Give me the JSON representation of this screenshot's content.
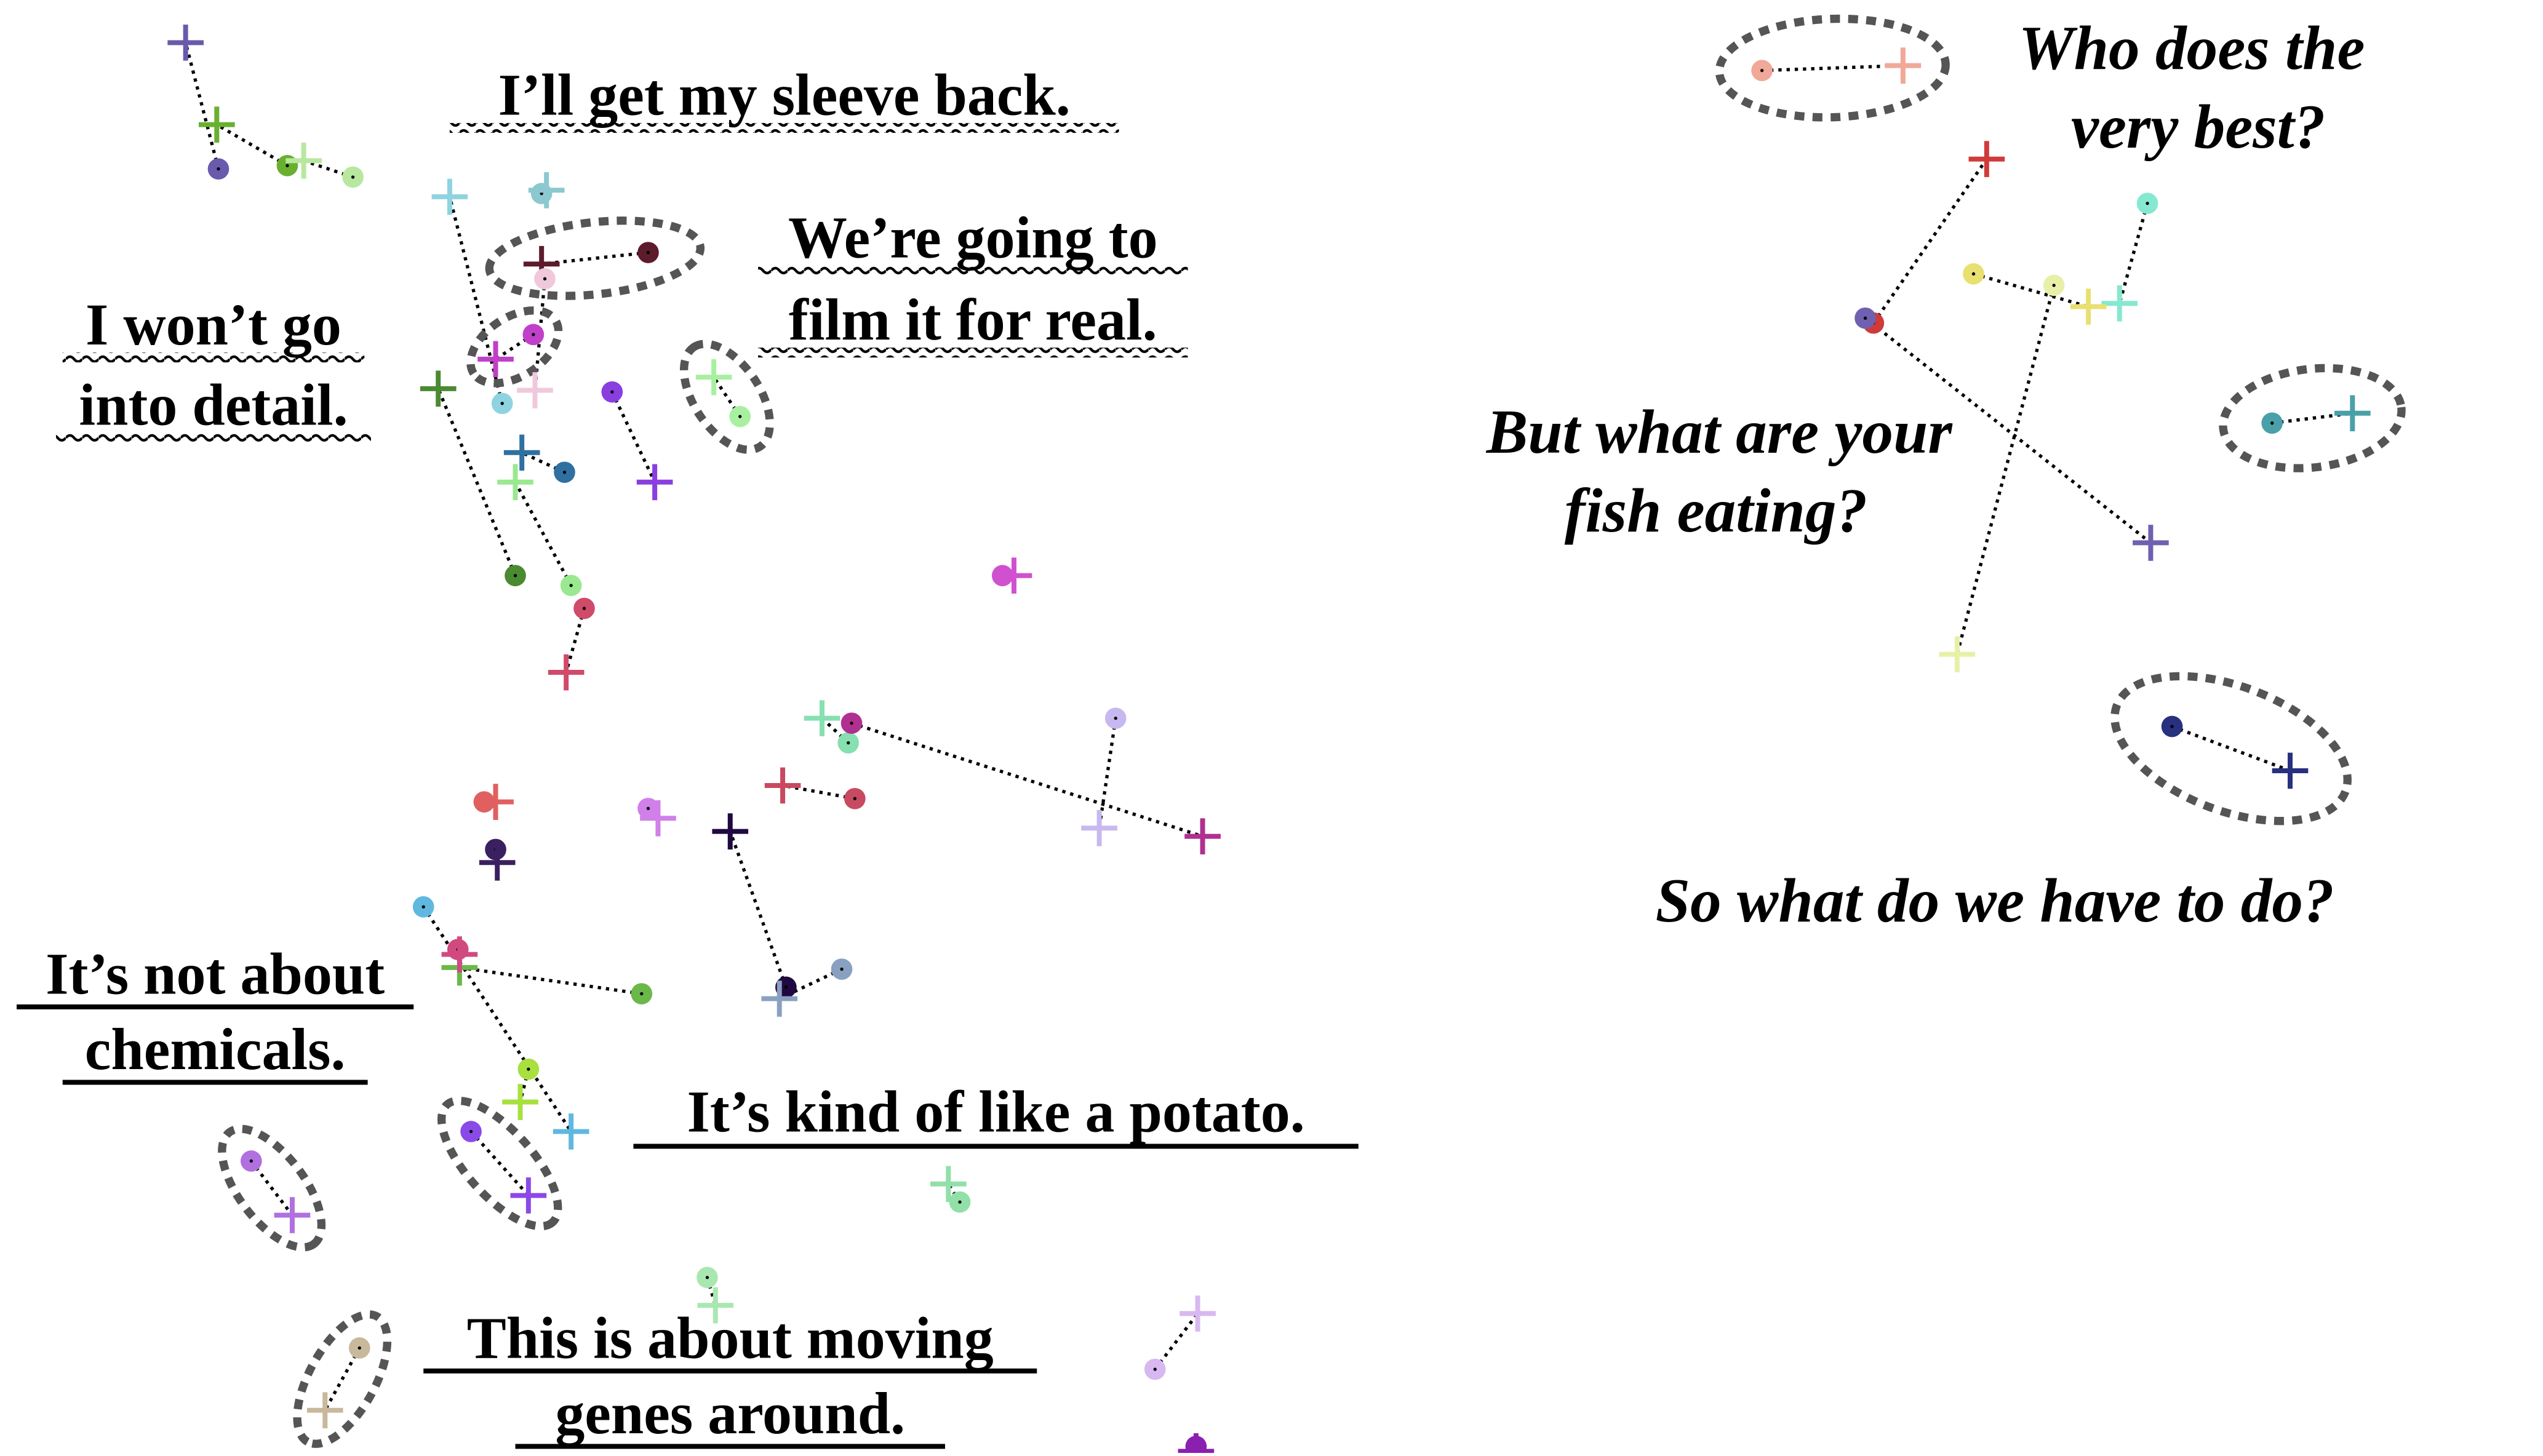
{
  "sentences": {
    "sleeve": "I’ll get my sleeve back.",
    "film_line1": "We’re going to",
    "film_line2": "film it for real.",
    "detail_line1": "I won’t go",
    "detail_line2": "into detail.",
    "chemicals_line1": "It’s not about",
    "chemicals_line2": "chemicals.",
    "potato": "It’s kind of like a potato.",
    "genes_line1": "This is about moving",
    "genes_line2": "genes around.",
    "best_line1": "Who does the",
    "best_line2": "very best?",
    "fish_line1": "But what are your",
    "fish_line2": "fish eating?",
    "todo": "So what do we have to do?"
  },
  "styles": {
    "wavy_underline": [
      "sleeve",
      "film",
      "detail"
    ],
    "straight_underline": [
      "chemicals",
      "potato",
      "genes"
    ],
    "italic_no_underline": [
      "best",
      "fish",
      "todo"
    ]
  },
  "marker_colors": {
    "dark_purple": "#7b6bb8",
    "grass_green": "#6ab030",
    "sky_cyan": "#8fd3e0",
    "maroon": "#5c1c2c",
    "magenta": "#c040c8",
    "violet": "#8a3ee0",
    "mint": "#86e0b0",
    "crimson": "#d04a6a",
    "salmon": "#f0a898",
    "red": "#d03a3a",
    "teal": "#4aa0a8",
    "navy": "#283080",
    "lilac": "#c8b8f0",
    "beige": "#c8b89c"
  }
}
